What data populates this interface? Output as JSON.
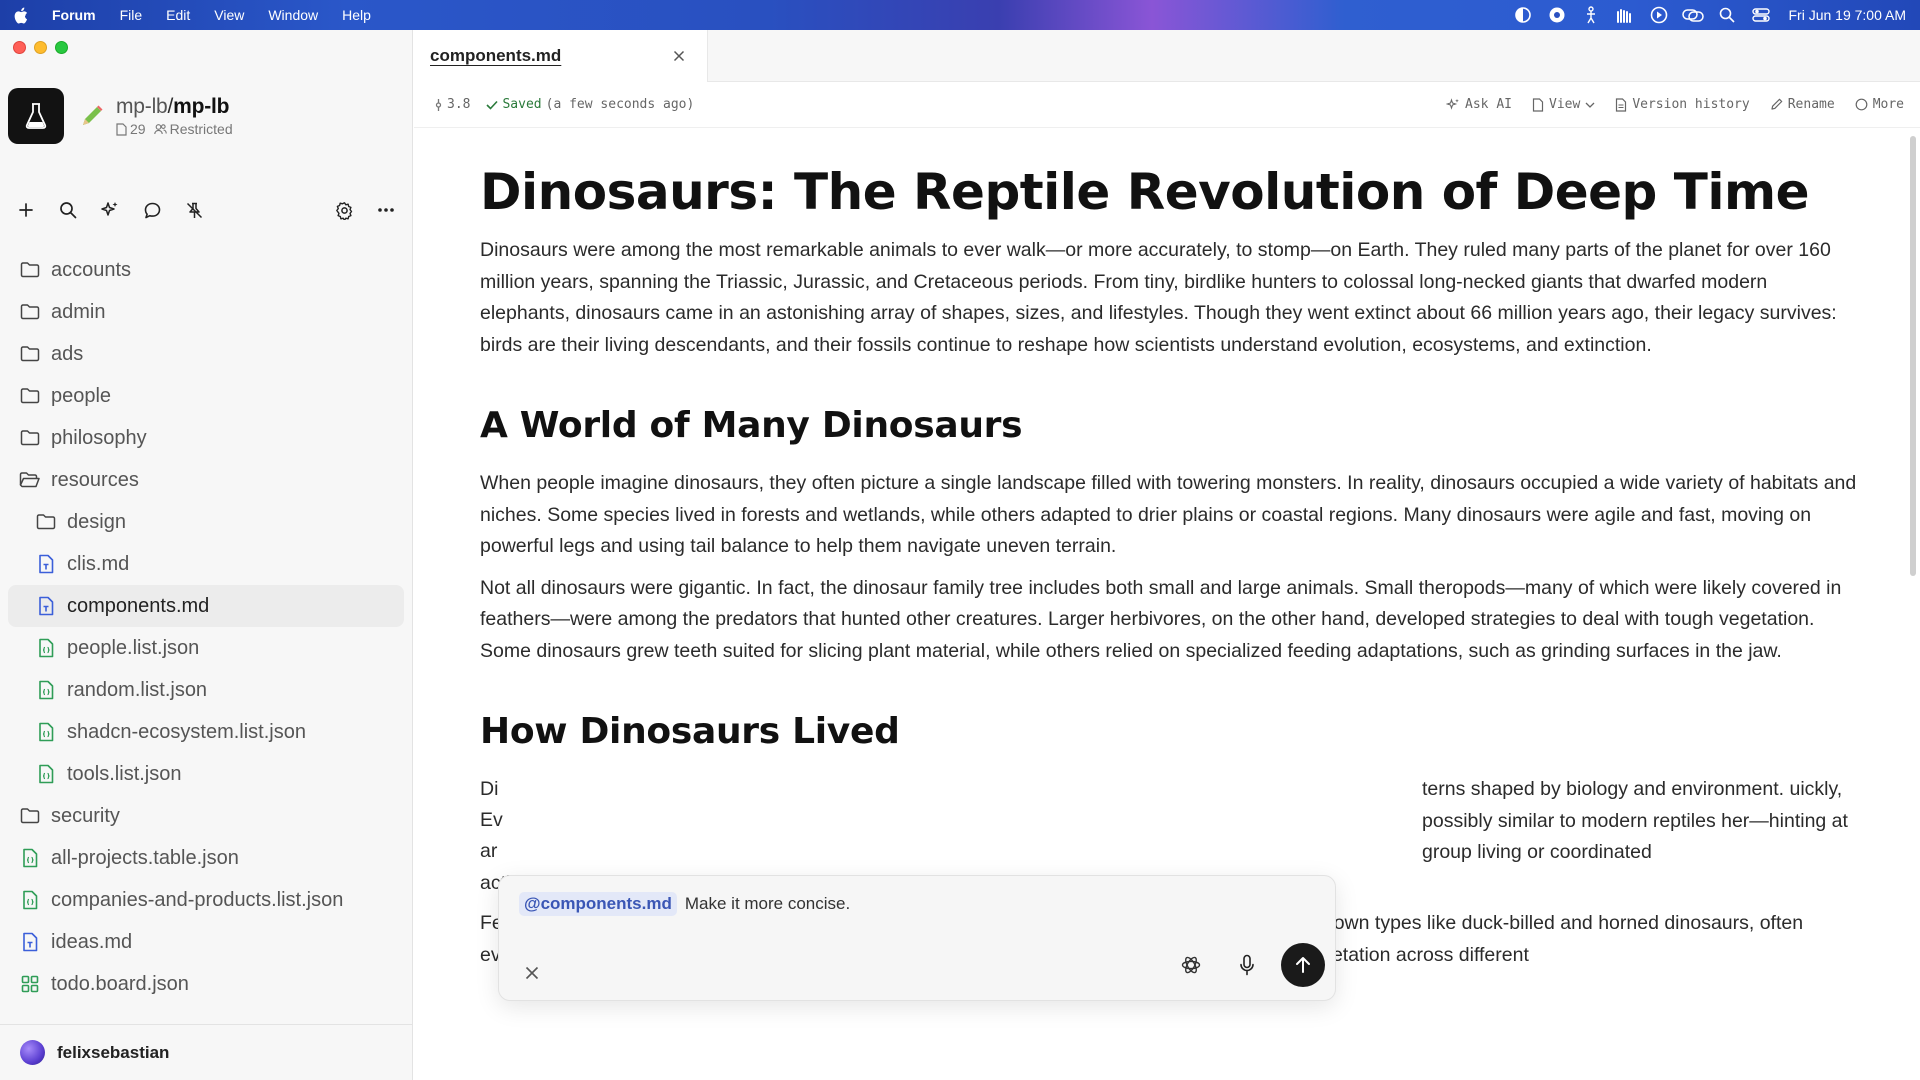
{
  "menubar": {
    "app_name": "Forum",
    "items": [
      "File",
      "Edit",
      "View",
      "Window",
      "Help"
    ],
    "clock": "Fri Jun 19  7:00 AM"
  },
  "sidebar": {
    "workspace": {
      "owner": "mp-lb",
      "name": "mp-lb",
      "doc_count": "29",
      "visibility": "Restricted"
    },
    "tree": [
      {
        "label": "accounts",
        "type": "folder",
        "level": 0
      },
      {
        "label": "admin",
        "type": "folder",
        "level": 0
      },
      {
        "label": "ads",
        "type": "folder",
        "level": 0
      },
      {
        "label": "people",
        "type": "folder",
        "level": 0
      },
      {
        "label": "philosophy",
        "type": "folder",
        "level": 0
      },
      {
        "label": "resources",
        "type": "folder-open",
        "level": 0
      },
      {
        "label": "design",
        "type": "folder",
        "level": 1
      },
      {
        "label": "clis.md",
        "type": "markdown",
        "level": 1
      },
      {
        "label": "components.md",
        "type": "markdown",
        "level": 1,
        "active": true
      },
      {
        "label": "people.list.json",
        "type": "json",
        "level": 1
      },
      {
        "label": "random.list.json",
        "type": "json",
        "level": 1
      },
      {
        "label": "shadcn-ecosystem.list.json",
        "type": "json",
        "level": 1
      },
      {
        "label": "tools.list.json",
        "type": "json",
        "level": 1
      },
      {
        "label": "security",
        "type": "folder",
        "level": 0
      },
      {
        "label": "all-projects.table.json",
        "type": "json",
        "level": 0
      },
      {
        "label": "companies-and-products.list.json",
        "type": "json",
        "level": 0
      },
      {
        "label": "ideas.md",
        "type": "markdown",
        "level": 0
      },
      {
        "label": "todo.board.json",
        "type": "board",
        "level": 0
      }
    ],
    "user": "felixsebastian"
  },
  "tab": {
    "label": "components.md"
  },
  "docbar": {
    "version": "3.8",
    "saved_label": "Saved",
    "saved_time": "(a few seconds ago)",
    "actions": {
      "ask_ai": "Ask AI",
      "view": "View",
      "version_history": "Version history",
      "rename": "Rename",
      "more": "More"
    }
  },
  "document": {
    "title": "Dinosaurs: The Reptile Revolution of Deep Time",
    "intro": "Dinosaurs were among the most remarkable animals to ever walk—or more accurately, to stomp—on Earth. They ruled many parts of the planet for over 160 million years, spanning the Triassic, Jurassic, and Cretaceous periods. From tiny, birdlike hunters to colossal long-necked giants that dwarfed modern elephants, dinosaurs came in an astonishing array of shapes, sizes, and lifestyles. Though they went extinct about 66 million years ago, their legacy survives: birds are their living descendants, and their fossils continue to reshape how scientists understand evolution, ecosystems, and extinction.",
    "section1_heading": "A World of Many Dinosaurs",
    "section1_p1": "When people imagine dinosaurs, they often picture a single landscape filled with towering monsters. In reality, dinosaurs occupied a wide variety of habitats and niches. Some species lived in forests and wetlands, while others adapted to drier plains or coastal regions. Many dinosaurs were agile and fast, moving on powerful legs and using tail balance to help them navigate uneven terrain.",
    "section1_p2": "Not all dinosaurs were gigantic. In fact, the dinosaur family tree includes both small and large animals. Small theropods—many of which were likely covered in feathers—were among the predators that hunted other creatures. Larger herbivores, on the other hand, developed strategies to deal with tough vegetation. Some dinosaurs grew teeth suited for slicing plant material, while others relied on specialized feeding adaptations, such as grinding surfaces in the jaw.",
    "section2_heading": "How Dinosaurs Lived",
    "section2_p1_visible_right": "terns shaped by biology and environment. uickly, possibly similar to modern reptiles her—hinting at group living or coordinated",
    "section2_p1_start": "Di",
    "section2_p1_line2_start": "Ev",
    "section2_p1_line3_start": "ar",
    "section2_p1_end": "activity.",
    "section2_p2": "Feeding strategies varied dramatically. Ornithischian dinosaurs, a major group that includes well-known types like duck-billed and horned dinosaurs, often evolved structures for processing plants. Others, such as sauropods, used long necks to reach vegetation across different"
  },
  "prompt": {
    "mention": "@components.md",
    "text": "Make it more concise."
  }
}
